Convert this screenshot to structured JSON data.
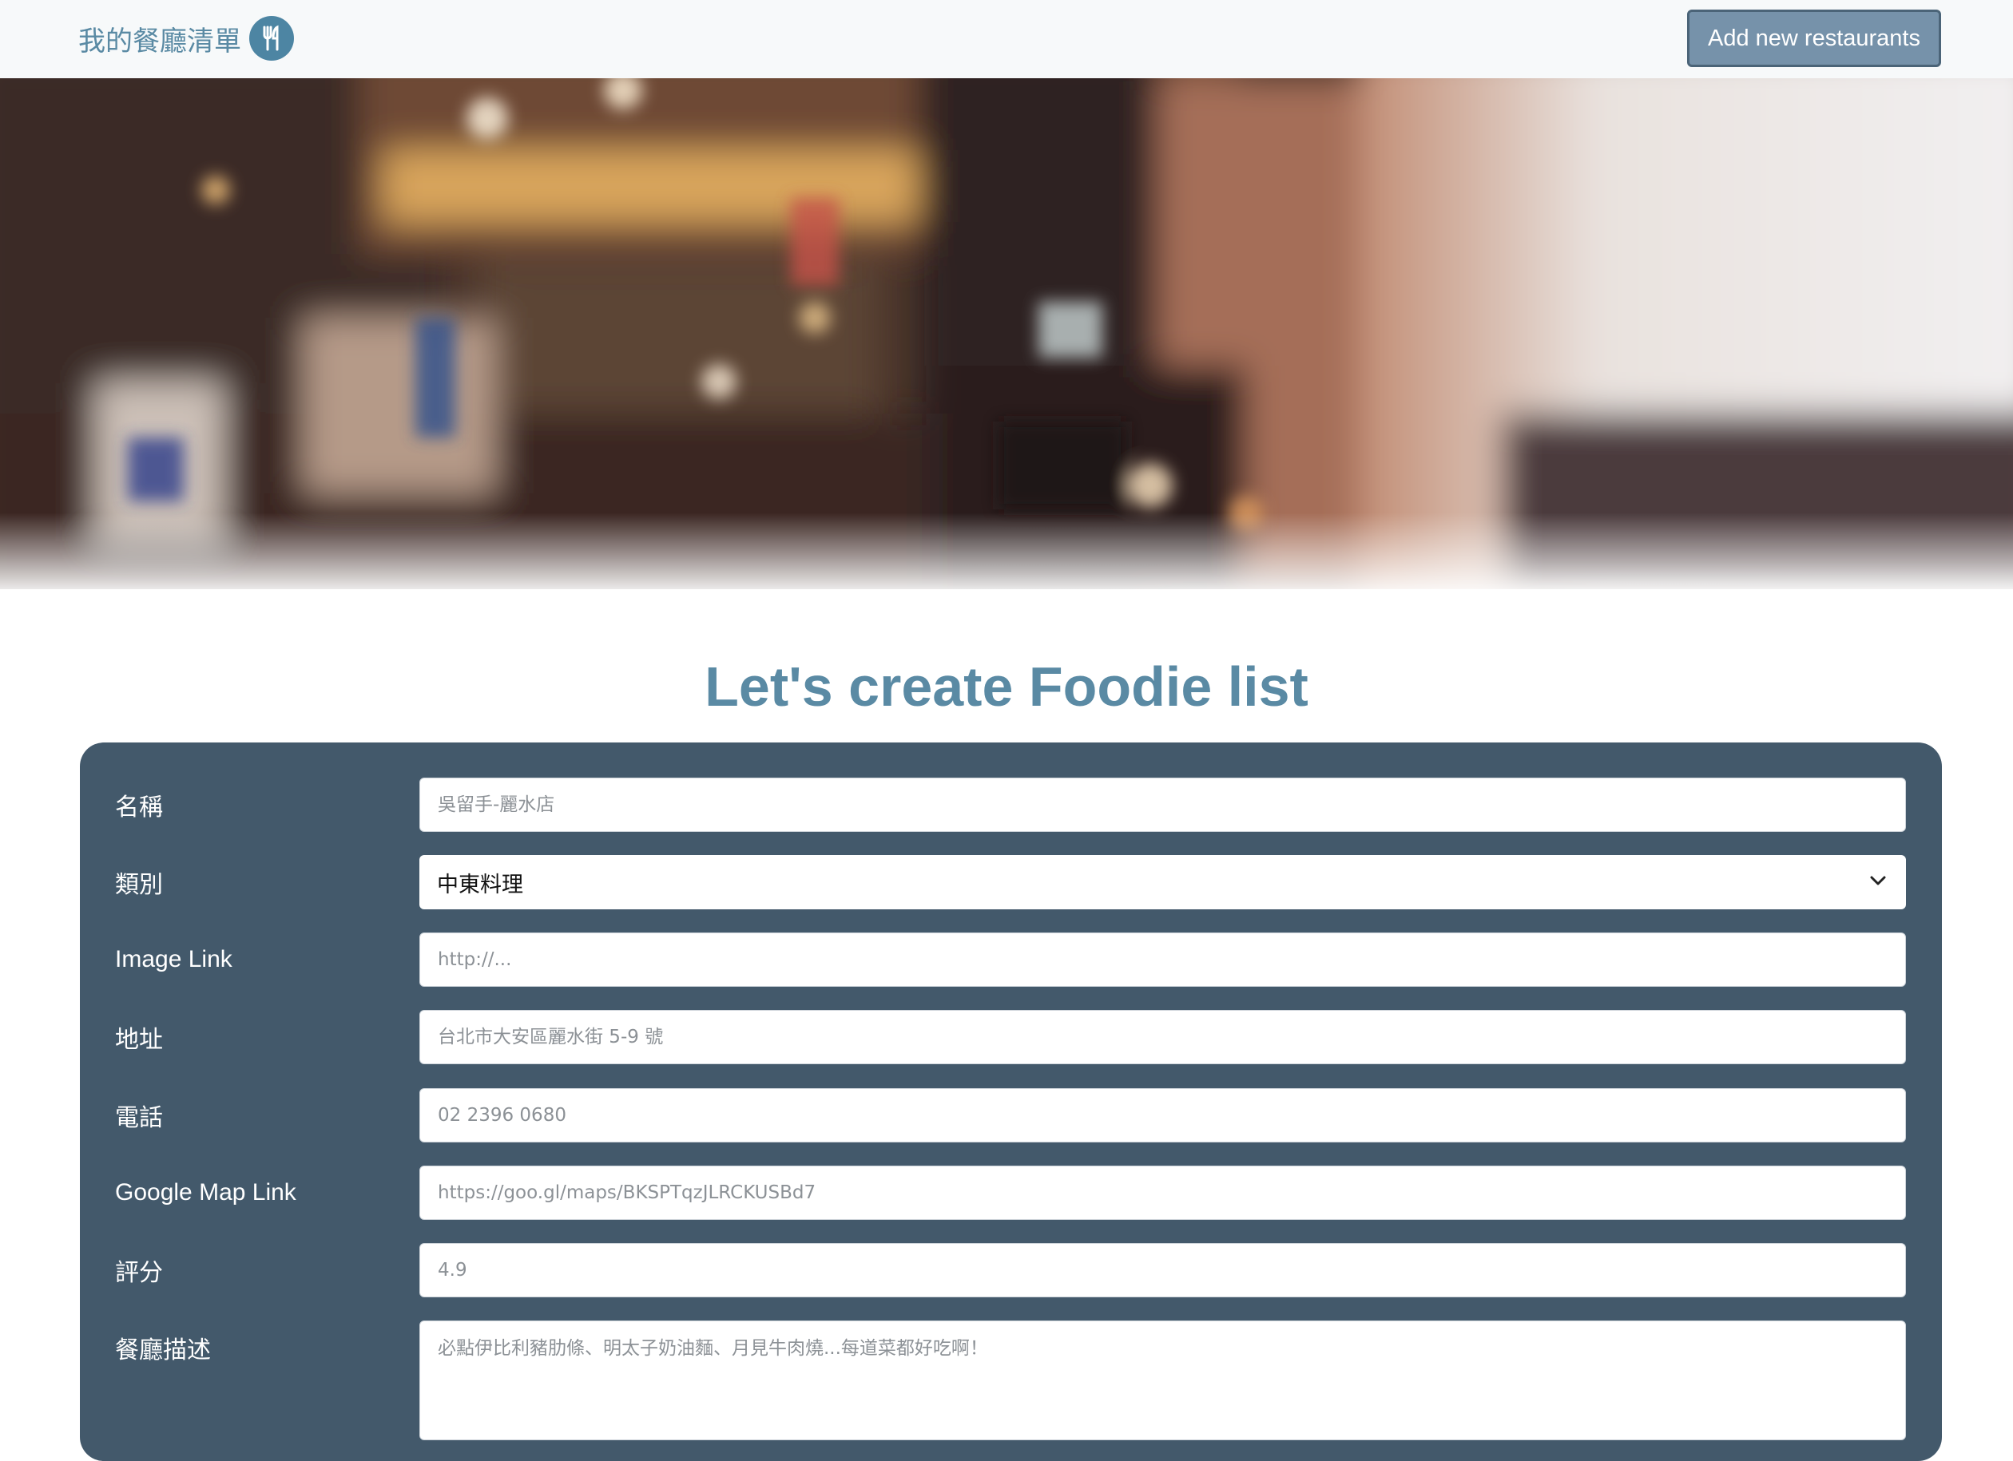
{
  "navbar": {
    "brand_label": "我的餐廳清單",
    "brand_icon": "utensils-icon",
    "add_button_label": "Add new restaurants",
    "brand_color": "#5a8aa4",
    "button_color": "#7692aa"
  },
  "banner": {
    "description_icon": "blurred-restaurant-photo"
  },
  "page": {
    "title": "Let's create Foodie list"
  },
  "form": {
    "panel_color": "#43596b",
    "name": {
      "label": "名稱",
      "placeholder": "吳留手-麗水店"
    },
    "category": {
      "label": "類別",
      "selected": "中東料理",
      "icon": "chevron-down-icon"
    },
    "image": {
      "label": "Image Link",
      "placeholder": "http://..."
    },
    "address": {
      "label": "地址",
      "placeholder": "台北市大安區麗水街 5-9 號"
    },
    "phone": {
      "label": "電話",
      "placeholder": "02 2396 0680"
    },
    "google_map": {
      "label": "Google Map Link",
      "placeholder": "https://goo.gl/maps/BKSPTqzJLRCKUSBd7"
    },
    "rating": {
      "label": "評分",
      "placeholder": "4.9"
    },
    "description": {
      "label": "餐廳描述",
      "placeholder": "必點伊比利豬肋條、明太子奶油麵、月見牛肉燒...每道菜都好吃啊！"
    }
  }
}
